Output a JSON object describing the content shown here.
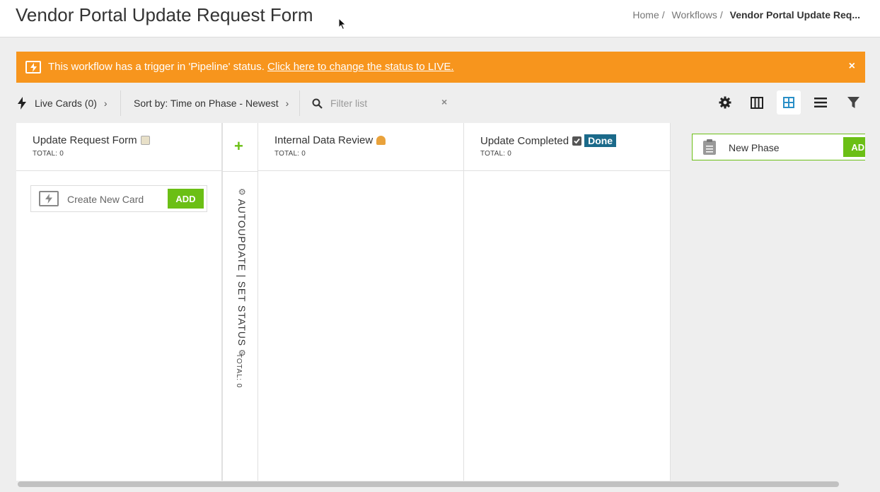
{
  "header": {
    "title": "Vendor Portal Update Request Form",
    "breadcrumb": [
      {
        "label": "Home"
      },
      {
        "label": "Workflows"
      },
      {
        "label": "Vendor Portal Update Req..."
      }
    ]
  },
  "alert": {
    "text": "This workflow has a trigger in 'Pipeline' status.",
    "link": "Click here to change the status to LIVE.",
    "close": "×"
  },
  "toolbar": {
    "live_cards": "Live Cards (0)",
    "sort": "Sort by: Time on Phase - Newest",
    "filter_placeholder": "Filter list",
    "filter_clear": "×"
  },
  "columns": [
    {
      "title": "Update Request Form",
      "total": "TOTAL: 0",
      "emoji": "notepad"
    },
    {
      "title": "Internal Data Review",
      "total": "TOTAL: 0",
      "emoji": "person-with-laptop"
    },
    {
      "title": "Update Completed",
      "total": "TOTAL: 0",
      "emoji": "check-box",
      "badge": "Done"
    }
  ],
  "create_card": {
    "label": "Create New Card",
    "button": "ADD"
  },
  "automation": {
    "label": "AUTOUPDATE | SET STATUS",
    "total": "TOTAL: 0",
    "plus": "+"
  },
  "new_phase": {
    "label": "New Phase",
    "button": "ADD"
  },
  "colors": {
    "alert": "#f7951d",
    "accent_green": "#6bbf15",
    "done_badge": "#1b6a8a",
    "active_view": "#2a8fc7"
  }
}
